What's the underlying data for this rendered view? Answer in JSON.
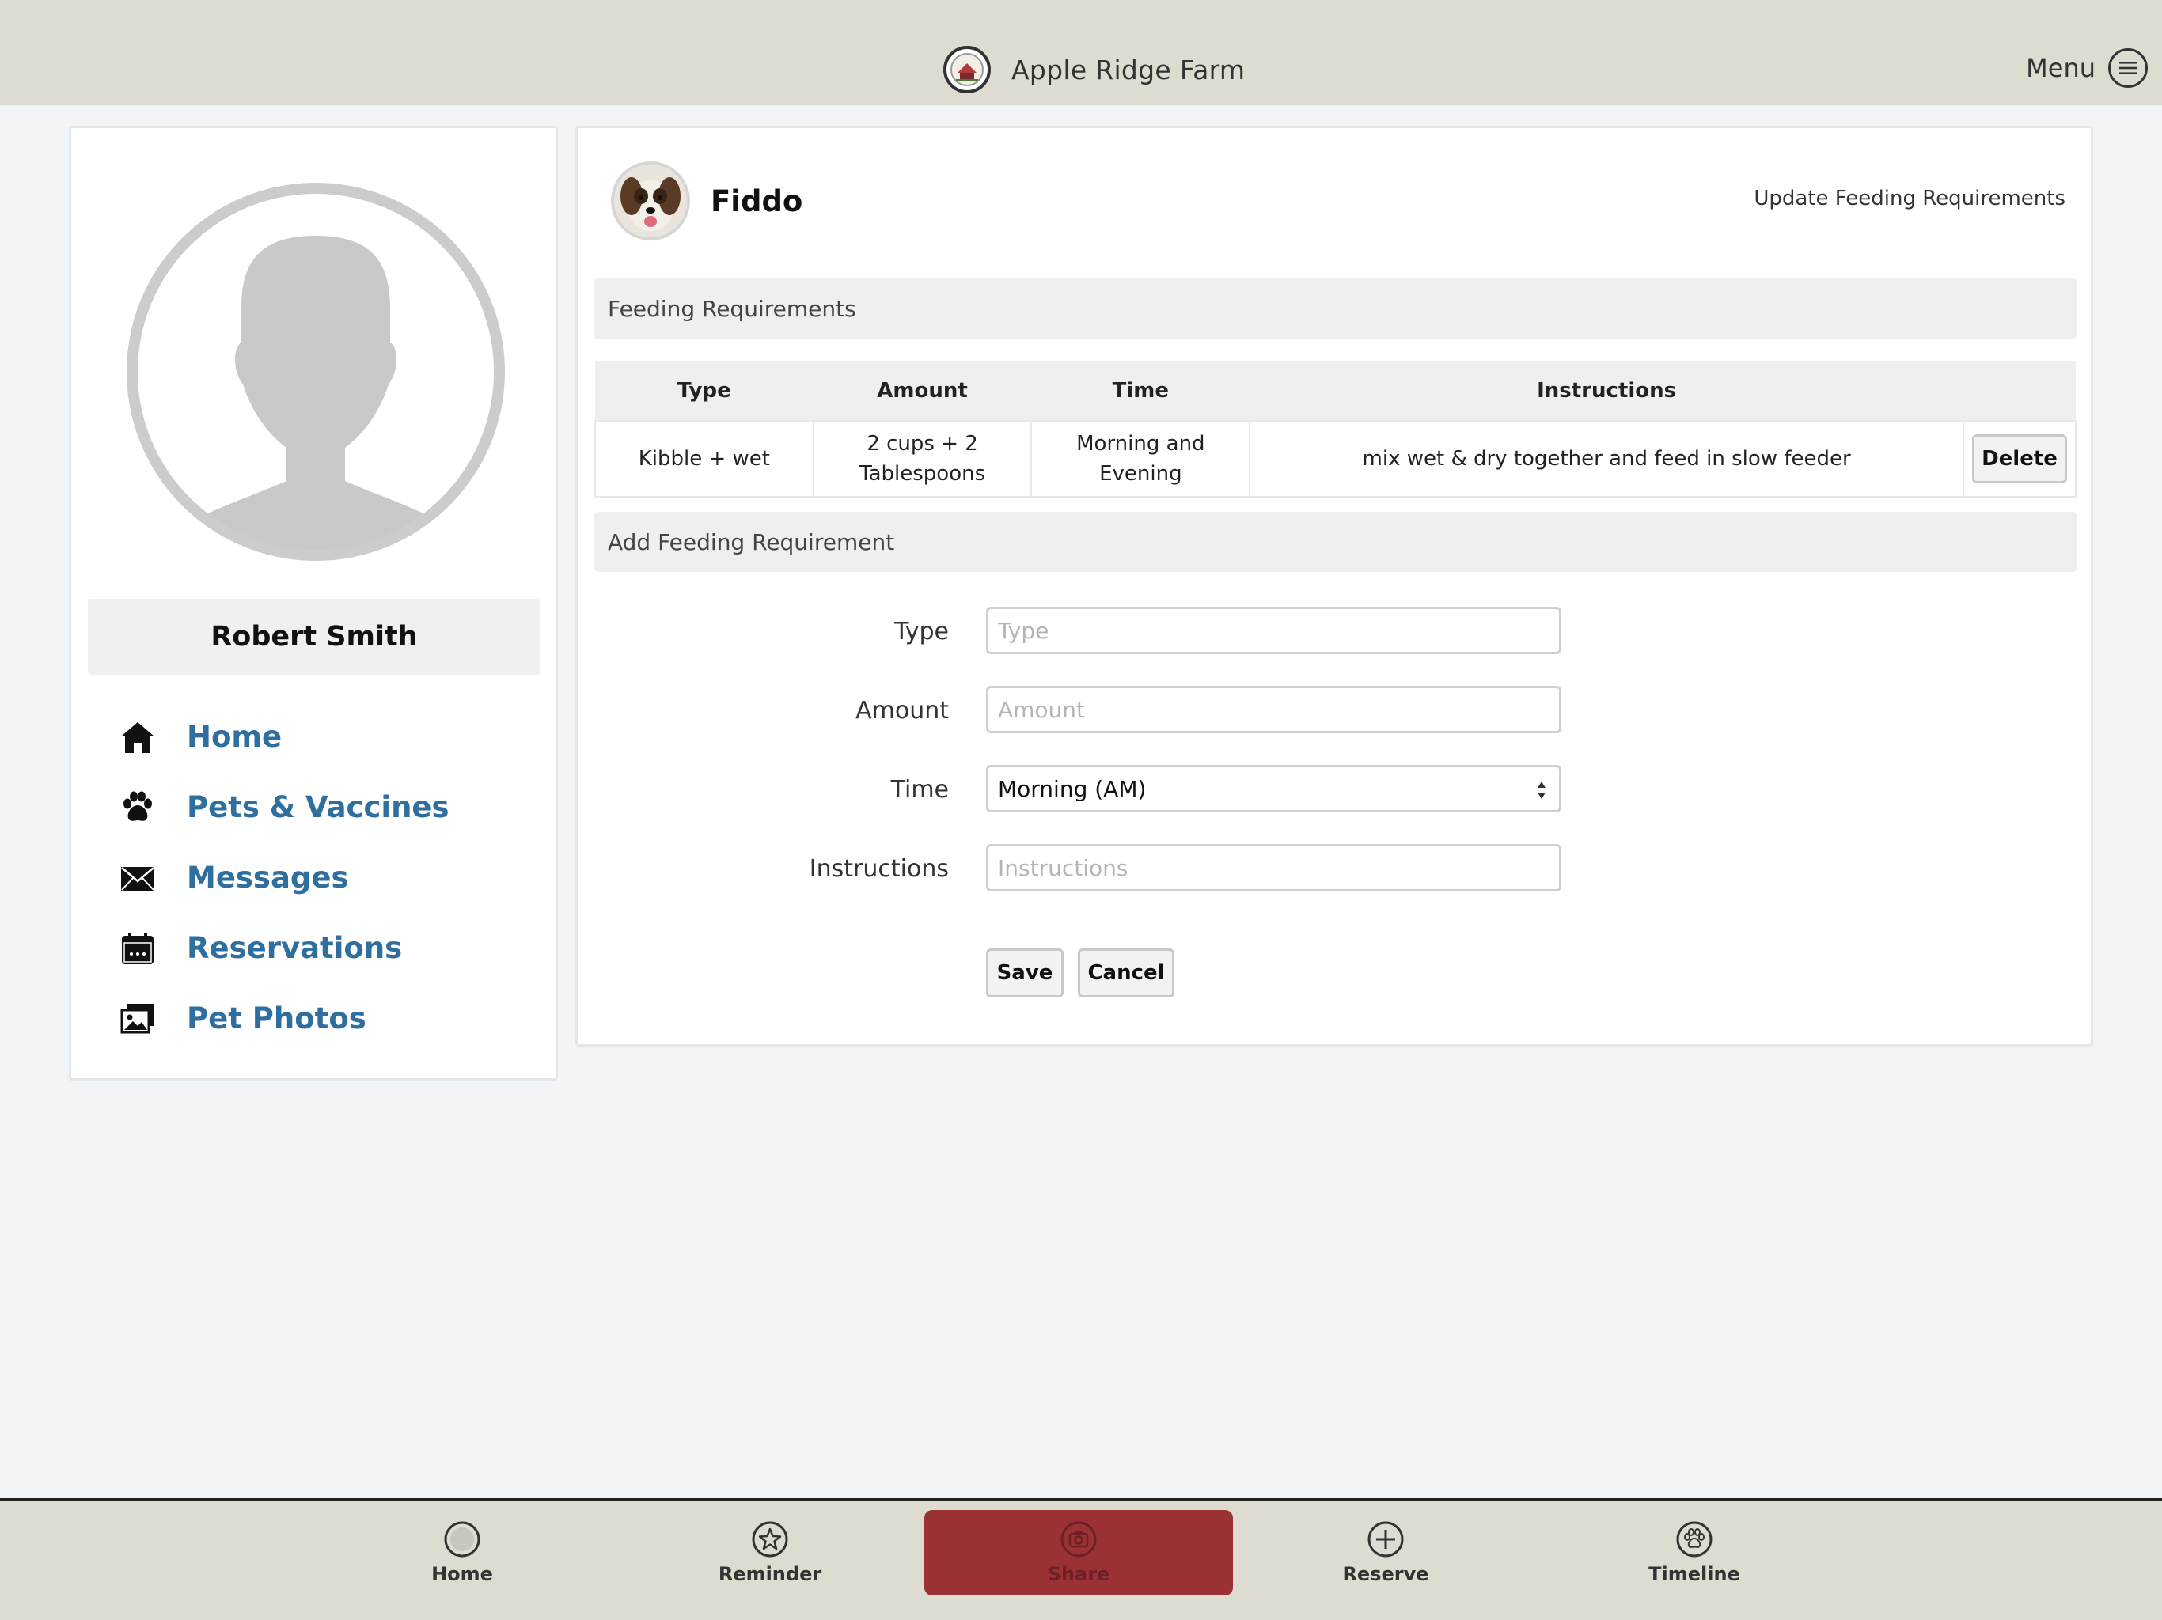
{
  "header": {
    "title": "Apple Ridge Farm",
    "menu_label": "Menu",
    "logo_icon": "farm-logo-icon",
    "menu_icon": "hamburger-menu-icon"
  },
  "sidebar": {
    "user_name": "Robert Smith",
    "avatar_icon": "user-silhouette-icon",
    "items": [
      {
        "label": "Home",
        "icon": "house-icon"
      },
      {
        "label": "Pets & Vaccines",
        "icon": "paw-icon"
      },
      {
        "label": "Messages",
        "icon": "envelope-icon"
      },
      {
        "label": "Reservations",
        "icon": "calendar-icon"
      },
      {
        "label": "Pet Photos",
        "icon": "photos-icon"
      }
    ]
  },
  "pet": {
    "name": "Fiddo",
    "update_link": "Update Feeding Requirements"
  },
  "feeding": {
    "section_title": "Feeding Requirements",
    "columns": [
      "Type",
      "Amount",
      "Time",
      "Instructions"
    ],
    "rows": [
      {
        "type": "Kibble + wet",
        "amount_line1": "2 cups + 2",
        "amount_line2": "Tablespoons",
        "time": "Morning and Evening",
        "instructions": "mix wet & dry together and feed in slow feeder",
        "delete_label": "Delete"
      }
    ]
  },
  "add_form": {
    "section_title": "Add Feeding Requirement",
    "type_label": "Type",
    "type_placeholder": "Type",
    "amount_label": "Amount",
    "amount_placeholder": "Amount",
    "time_label": "Time",
    "time_selected": "Morning (AM)",
    "instructions_label": "Instructions",
    "instructions_placeholder": "Instructions",
    "save_label": "Save",
    "cancel_label": "Cancel"
  },
  "tabbar": {
    "tabs": [
      {
        "label": "Home",
        "icon": "home-circle-icon"
      },
      {
        "label": "Reminder",
        "icon": "star-icon"
      },
      {
        "label": "Share",
        "icon": "camera-icon"
      },
      {
        "label": "Reserve",
        "icon": "plus-icon"
      },
      {
        "label": "Timeline",
        "icon": "paw-circle-icon"
      }
    ]
  },
  "colors": {
    "bar_background": "#dedcd1",
    "page_background": "#f2f5f7",
    "nav_link": "#2f6f9f",
    "share_accent": "#9a3235"
  }
}
